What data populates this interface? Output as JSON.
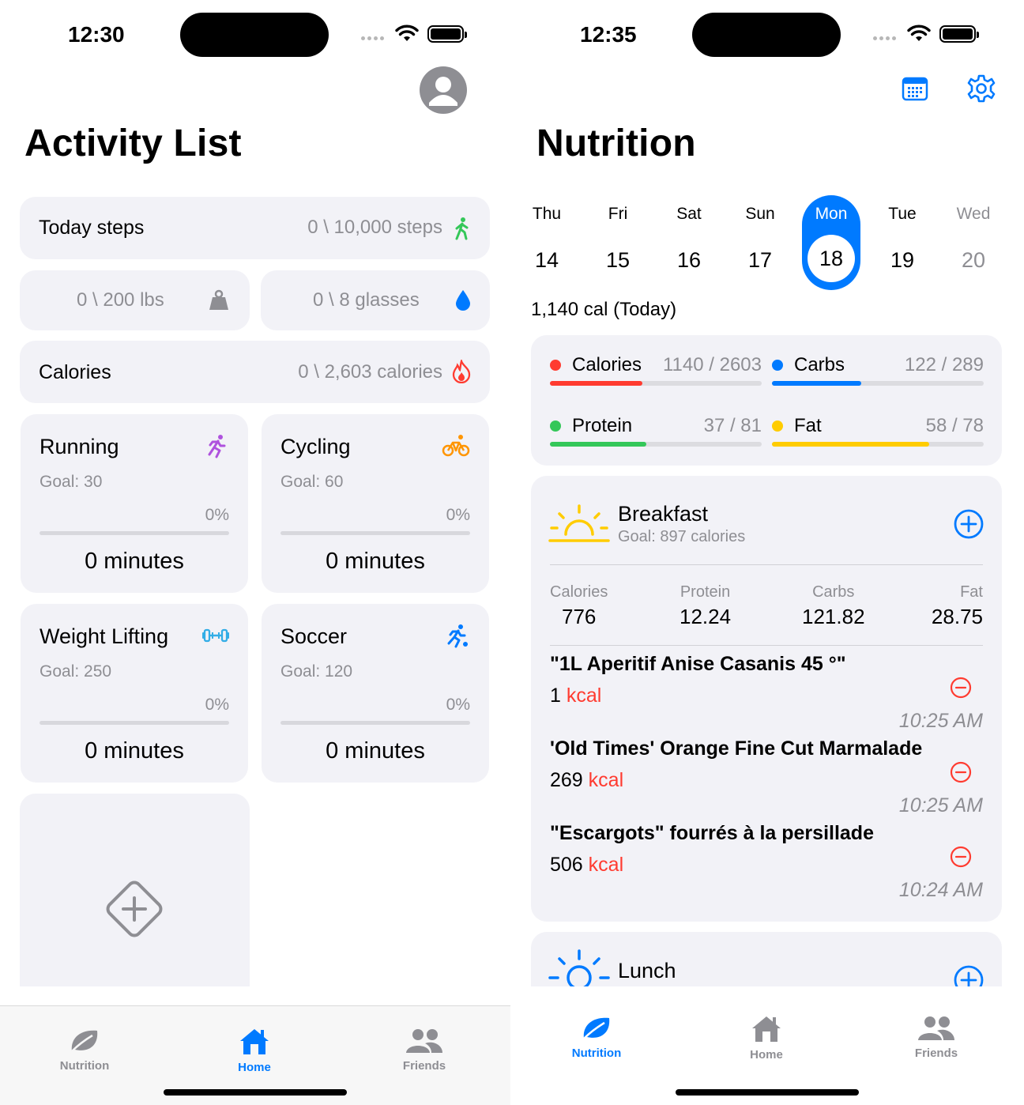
{
  "left": {
    "status_time": "12:30",
    "title": "Activity List",
    "steps": {
      "label": "Today steps",
      "value": "0 \\ 10,000 steps"
    },
    "weight": {
      "value": "0 \\ 200 lbs"
    },
    "water": {
      "value": "0 \\ 8 glasses"
    },
    "calories": {
      "label": "Calories",
      "value": "0 \\ 2,603 calories"
    },
    "activities": [
      {
        "name": "Running",
        "goal": "Goal: 30",
        "percent": "0%",
        "minutes": "0 minutes",
        "icon": "running-icon",
        "color": "#af52de"
      },
      {
        "name": "Cycling",
        "goal": "Goal: 60",
        "percent": "0%",
        "minutes": "0 minutes",
        "icon": "cycling-icon",
        "color": "#ff9500"
      },
      {
        "name": "Weight Lifting",
        "goal": "Goal: 250",
        "percent": "0%",
        "minutes": "0 minutes",
        "icon": "dumbbell-icon",
        "color": "#32ade6"
      },
      {
        "name": "Soccer",
        "goal": "Goal: 120",
        "percent": "0%",
        "minutes": "0 minutes",
        "icon": "soccer-icon",
        "color": "#007aff"
      }
    ],
    "tabs": {
      "nutrition": "Nutrition",
      "home": "Home",
      "friends": "Friends",
      "active": "Home"
    }
  },
  "right": {
    "status_time": "12:35",
    "title": "Nutrition",
    "days": [
      {
        "name": "Thu",
        "date": "14"
      },
      {
        "name": "Fri",
        "date": "15"
      },
      {
        "name": "Sat",
        "date": "16"
      },
      {
        "name": "Sun",
        "date": "17"
      },
      {
        "name": "Mon",
        "date": "18"
      },
      {
        "name": "Tue",
        "date": "19"
      },
      {
        "name": "Wed",
        "date": "20"
      }
    ],
    "selected_day": "Mon",
    "today_summary": "1,140 cal (Today)",
    "macros": {
      "calories": {
        "label": "Calories",
        "value": "1140 / 2603",
        "fraction": 0.438,
        "color": "#ff3b30"
      },
      "carbs": {
        "label": "Carbs",
        "value": "122 / 289",
        "fraction": 0.422,
        "color": "#007aff"
      },
      "protein": {
        "label": "Protein",
        "value": "37 / 81",
        "fraction": 0.457,
        "color": "#34c759"
      },
      "fat": {
        "label": "Fat",
        "value": "58 / 78",
        "fraction": 0.744,
        "color": "#ffcc00"
      }
    },
    "breakfast": {
      "title": "Breakfast",
      "goal": "Goal: 897 calories",
      "stats": [
        {
          "label": "Calories",
          "value": "776"
        },
        {
          "label": "Protein",
          "value": "12.24"
        },
        {
          "label": "Carbs",
          "value": "121.82"
        },
        {
          "label": "Fat",
          "value": "28.75"
        }
      ],
      "items": [
        {
          "name": "\"1L Aperitif Anise Casanis 45 °\"",
          "kcal": "1",
          "unit": "kcal",
          "time": "10:25 AM"
        },
        {
          "name": "'Old Times' Orange Fine Cut Marmalade",
          "kcal": "269",
          "unit": "kcal",
          "time": "10:25 AM"
        },
        {
          "name": "\"Escargots\" fourrés à la persillade",
          "kcal": "506",
          "unit": "kcal",
          "time": "10:24 AM"
        }
      ]
    },
    "lunch": {
      "title": "Lunch"
    },
    "tabs": {
      "nutrition": "Nutrition",
      "home": "Home",
      "friends": "Friends",
      "active": "Nutrition"
    }
  },
  "colors": {
    "accent": "#007aff",
    "inactive": "#8e8e93",
    "card": "#f2f2f7",
    "danger": "#ff3b30"
  }
}
